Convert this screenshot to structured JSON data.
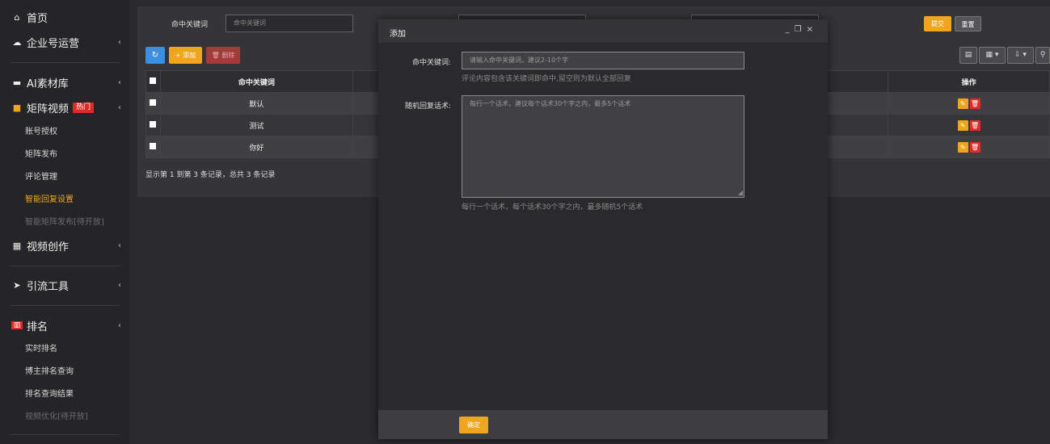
{
  "sidebar": {
    "home": "首页",
    "enterprise": "企业号运营",
    "ai_library": "AI素材库",
    "matrix_video": "矩阵视频",
    "hot_badge": "热门",
    "matrix_sub": [
      "账号授权",
      "矩阵发布",
      "评论管理",
      "智能回复设置",
      "智能矩阵发布[待开放]"
    ],
    "video_create": "视频创作",
    "traffic_tools": "引流工具",
    "ranking": "排名",
    "ranking_sub": [
      "实时排名",
      "博主排名查询",
      "排名查询结果",
      "视频优化[待开放]"
    ]
  },
  "search": {
    "label": "命中关键词",
    "placeholder": "命中关键词",
    "submit": "提交",
    "reset": "重置"
  },
  "toolbar": {
    "add": "+ 添加",
    "delete": "🗑 删除"
  },
  "table": {
    "col_keyword": "命中关键词",
    "col_action": "操作",
    "rows": [
      "默认",
      "测试",
      "你好"
    ],
    "summary": "显示第 1 到第 3 条记录，总共 3 条记录"
  },
  "modal": {
    "title": "添加",
    "keyword_label": "命中关键词:",
    "keyword_placeholder": "请输入命中关键词，建议2-10个字",
    "keyword_hint": "评论内容包含该关键词即命中,留空则为默认全部回复",
    "reply_label": "随机回复话术:",
    "reply_placeholder": "每行一个话术，建议每个话术30个字之内，最多5个话术",
    "reply_hint": "每行一个话术，每个话术30个字之内，最多随机5个话术",
    "ok": "确定"
  }
}
